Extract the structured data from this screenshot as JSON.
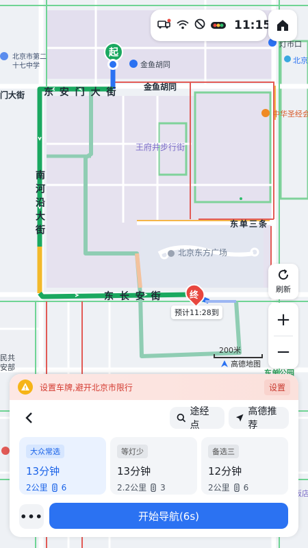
{
  "status": {
    "time": "11:15"
  },
  "map": {
    "labels": {
      "dongcheng_school_1": "北京市第二",
      "dongcheng_school_2": "十七中学",
      "jinyu_hutong_top": "金鱼胡同",
      "jinyu_hutong_road": "金鱼胡同",
      "dengshikou": "灯市口",
      "beijing_right": "北京",
      "zhonghua_church": "中华圣经会",
      "wangfujing": "王府井步行街",
      "dongdan_santiao": "东单三条",
      "oriental_plaza": "北京东方广场",
      "tiananmen_st": "门大街",
      "donganmen": "东 安 门 大 街",
      "nanheyan": "南河沿大街",
      "changan": "东 长 安 街",
      "people_1": "民共",
      "people_2": "安部",
      "dongdan_park": "东单公园",
      "hotel": "饭店"
    },
    "start_marker": "起",
    "end_marker": "终",
    "eta_bubble": "预计11:28到",
    "scale": "200米",
    "brand": "高德地图"
  },
  "controls": {
    "refresh": "刷新",
    "zoom_in": "+",
    "zoom_out": "−"
  },
  "restriction": {
    "text": "设置车牌,避开北京市限行",
    "button": "设置"
  },
  "panel": {
    "waypoint_label": "途经点",
    "recommend_label": "高德推荐",
    "routes": [
      {
        "tag": "大众常选",
        "time": "13分钟",
        "distance": "2公里",
        "lights": "6"
      },
      {
        "tag": "等灯少",
        "time": "13分钟",
        "distance": "2.2公里",
        "lights": "3"
      },
      {
        "tag": "备选三",
        "time": "12分钟",
        "distance": "2公里",
        "lights": "6"
      }
    ],
    "more_label": "•••",
    "start_nav_label": "开始导航(6s)"
  },
  "colors": {
    "accent": "#2b72f2",
    "route_green": "#1aa860",
    "alt_route": "#8fcdb3",
    "warning": "#d43b31"
  }
}
